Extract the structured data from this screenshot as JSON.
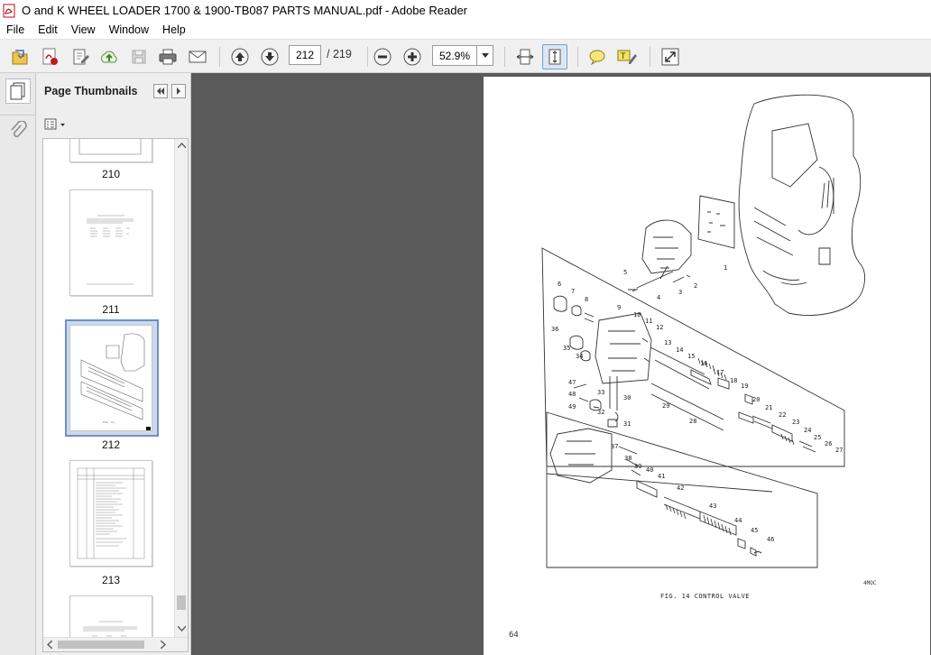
{
  "window": {
    "title": "O and K WHEEL LOADER 1700 & 1900-TB087 PARTS MANUAL.pdf - Adobe Reader"
  },
  "menu": {
    "items": [
      "File",
      "Edit",
      "View",
      "Window",
      "Help"
    ]
  },
  "toolbar": {
    "current_page": "212",
    "page_total": "/ 219",
    "zoom": "52.9%"
  },
  "nav_panel": {
    "title": "Page Thumbnails",
    "thumbnails": [
      {
        "label": "210"
      },
      {
        "label": "211"
      },
      {
        "label": "212",
        "selected": true
      },
      {
        "label": "213"
      }
    ]
  },
  "document": {
    "page_number": "64",
    "figure_caption": "FIG. 14  CONTROL VALVE",
    "figure_code": "4MOC",
    "callouts": [
      "1",
      "2",
      "3",
      "4",
      "5",
      "6",
      "7",
      "8",
      "9",
      "10",
      "11",
      "12",
      "13",
      "14",
      "15",
      "16",
      "17",
      "18",
      "19",
      "20",
      "21",
      "22",
      "23",
      "24",
      "25",
      "26",
      "27",
      "28",
      "29",
      "30",
      "31",
      "32",
      "33",
      "34",
      "35",
      "36",
      "37",
      "38",
      "39",
      "40",
      "41",
      "42",
      "43",
      "44",
      "45",
      "46",
      "47",
      "48",
      "49"
    ]
  },
  "icons": {
    "open": "open-icon",
    "create_pdf": "create-pdf-icon",
    "edit": "edit-icon",
    "upload": "upload-icon",
    "save": "save-icon",
    "print": "print-icon",
    "email": "email-icon"
  },
  "colors": {
    "doc_background": "#5a5a5a",
    "panel_background": "#eeeeee",
    "selection": "#6d8fc4"
  }
}
